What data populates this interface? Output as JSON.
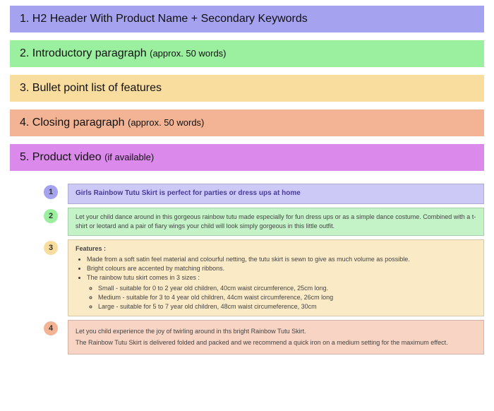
{
  "legend": [
    {
      "num": "1.",
      "text": "H2 Header With Product Name + Secondary Keywords",
      "small": "",
      "colorClass": "bg-purple"
    },
    {
      "num": "2.",
      "text": "Introductory paragraph",
      "small": "(approx. 50 words)",
      "colorClass": "bg-green"
    },
    {
      "num": "3.",
      "text": "Bullet point list of features",
      "small": "",
      "colorClass": "bg-yellow"
    },
    {
      "num": "4.",
      "text": "Closing paragraph",
      "small": "(approx. 50 words)",
      "colorClass": "bg-orange"
    },
    {
      "num": "5.",
      "text": "Product video",
      "small": "(if available)",
      "colorClass": "bg-magenta"
    }
  ],
  "example": {
    "header": "Girls Rainbow Tutu Skirt is perfect for parties or dress ups at home",
    "intro": "Let your child dance around in this gorgeous rainbow tutu made especially for fun dress ups or as a simple dance costume. Combined with a t-shirt or leotard and a pair of fiary wings your child will look simply gorgeous in this little outfit.",
    "features_label": "Features :",
    "features": [
      "Made from a soft satin feel material and colourful netting, the tutu skirt is sewn to give as much volume as possible.",
      "Bright colours are accented by matching ribbons.",
      "The rainbow tutu skirt comes in 3 sizes  :"
    ],
    "sizes": [
      "Small - suitable for 0 to 2 year old children, 40cm waist circumference, 25cm long.",
      "Medium - suitable for 3 to 4 year old children, 44cm waist circumference, 26cm long",
      "Large - suitable for 5 to 7 year old children, 48cm waist circumeference, 30cm"
    ],
    "closing1": "Let you child experience the joy of twirling around in ths bright Rainbow Tutu Skirt.",
    "closing2": "The Rainbow Tutu Skirt is delivered folded and packed and we recommend a quick iron on a medium setting for the maximum effect."
  },
  "badges": [
    "1",
    "2",
    "3",
    "4"
  ]
}
